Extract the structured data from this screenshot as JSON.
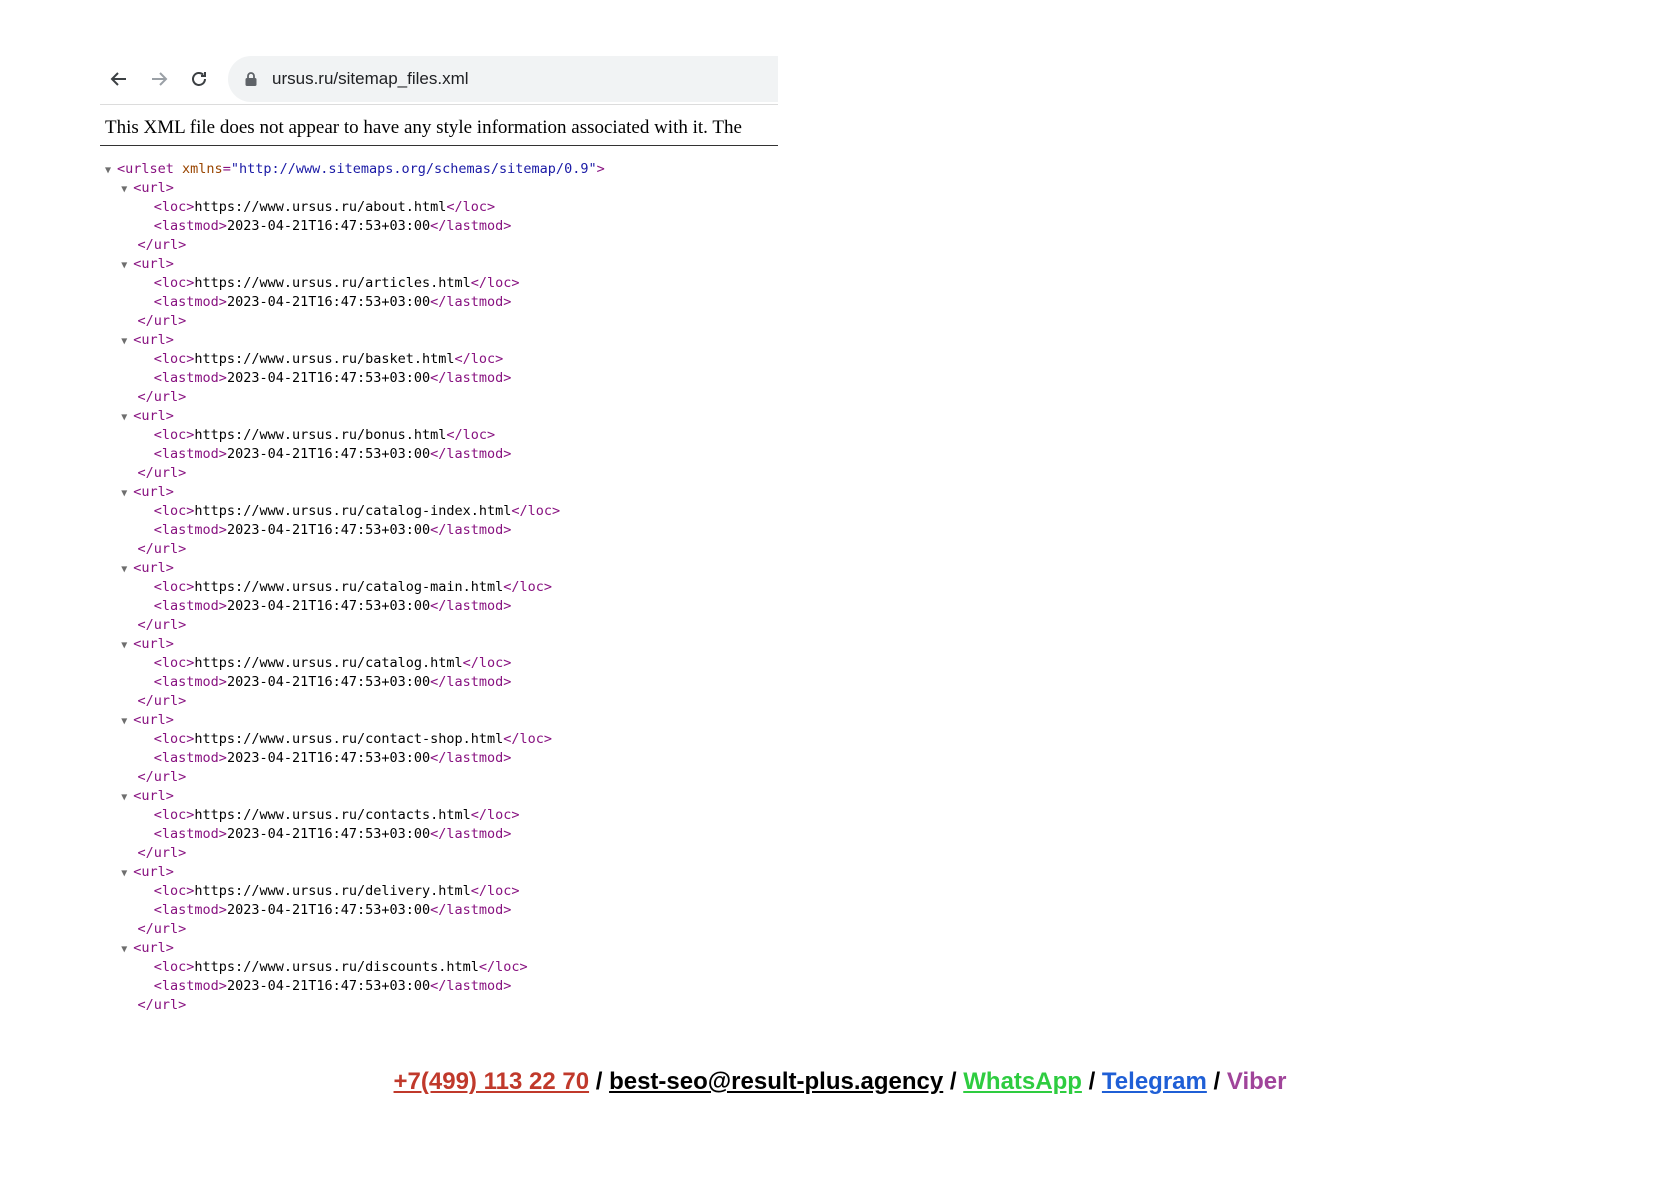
{
  "browser": {
    "address": "ursus.ru/sitemap_files.xml",
    "icons": {
      "back": "arrow-left-icon",
      "forward": "arrow-right-icon",
      "reload": "reload-icon",
      "lock": "lock-icon"
    }
  },
  "notice": "This XML file does not appear to have any style information associated with it. The",
  "xml": {
    "root_open": "<urlset",
    "root_attr": "xmlns",
    "root_attr_value": "\"http://www.sitemaps.org/schemas/sitemap/0.9\"",
    "url_open": "<url>",
    "url_close": "</url>",
    "loc_open": "<loc>",
    "loc_close": "</loc>",
    "lastmod_open": "<lastmod>",
    "lastmod_close": "</lastmod>",
    "entries": [
      {
        "loc": "https://www.ursus.ru/about.html",
        "lastmod": "2023-04-21T16:47:53+03:00"
      },
      {
        "loc": "https://www.ursus.ru/articles.html",
        "lastmod": "2023-04-21T16:47:53+03:00"
      },
      {
        "loc": "https://www.ursus.ru/basket.html",
        "lastmod": "2023-04-21T16:47:53+03:00"
      },
      {
        "loc": "https://www.ursus.ru/bonus.html",
        "lastmod": "2023-04-21T16:47:53+03:00"
      },
      {
        "loc": "https://www.ursus.ru/catalog-index.html",
        "lastmod": "2023-04-21T16:47:53+03:00"
      },
      {
        "loc": "https://www.ursus.ru/catalog-main.html",
        "lastmod": "2023-04-21T16:47:53+03:00"
      },
      {
        "loc": "https://www.ursus.ru/catalog.html",
        "lastmod": "2023-04-21T16:47:53+03:00"
      },
      {
        "loc": "https://www.ursus.ru/contact-shop.html",
        "lastmod": "2023-04-21T16:47:53+03:00"
      },
      {
        "loc": "https://www.ursus.ru/contacts.html",
        "lastmod": "2023-04-21T16:47:53+03:00"
      },
      {
        "loc": "https://www.ursus.ru/delivery.html",
        "lastmod": "2023-04-21T16:47:53+03:00"
      },
      {
        "loc": "https://www.ursus.ru/discounts.html",
        "lastmod": "2023-04-21T16:47:53+03:00"
      }
    ],
    "colors": {
      "tag": "#881280",
      "attr": "#994500",
      "attr_value": "#1a1aa6"
    }
  },
  "footer": {
    "phone": "+7(499) 113 22 70",
    "email": "best-seo@result-plus.agency",
    "whatsapp": "WhatsApp",
    "telegram": "Telegram",
    "viber": "Viber",
    "separator": " / ",
    "colors": {
      "phone": "#c0392b",
      "email": "#000000",
      "whatsapp": "#2ecc40",
      "telegram": "#1f5fd6",
      "viber": "#a0449a"
    }
  }
}
